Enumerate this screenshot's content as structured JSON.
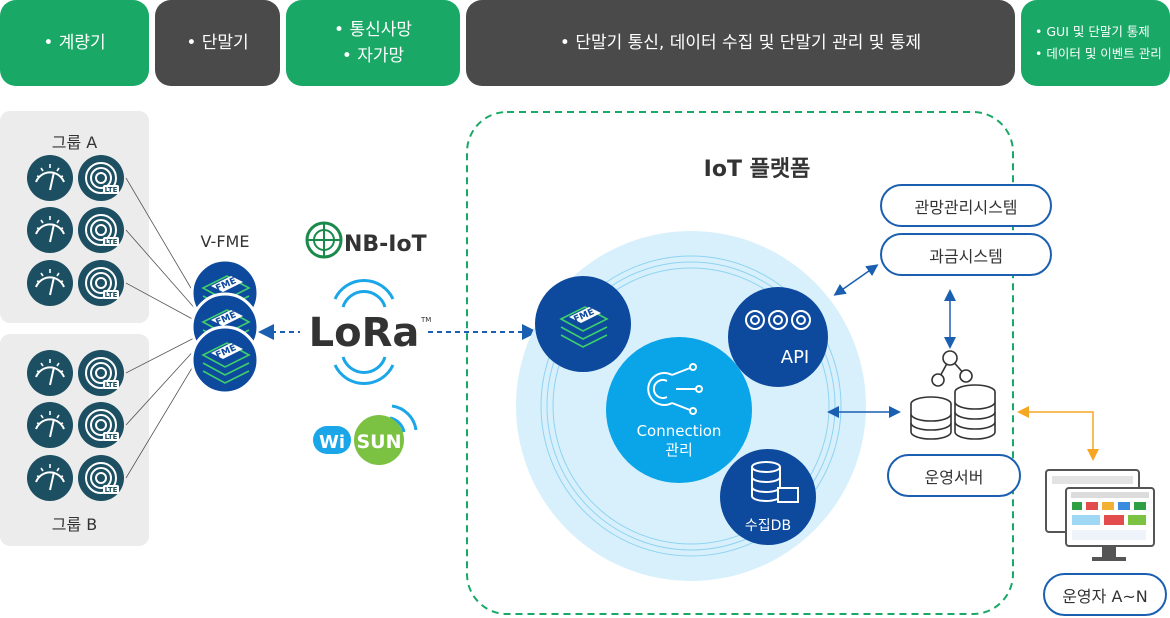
{
  "header": {
    "meter": "계량기",
    "terminal": "단말기",
    "network_1": "통신사망",
    "network_2": "자가망",
    "platform": "단말기 통신, 데이터 수집 및 단말기 관리 및 통제",
    "gui_1": "GUI 및 단말기 통제",
    "gui_2": "데이터 및 이벤트 관리"
  },
  "groups": {
    "a_label": "그룹 A",
    "b_label": "그룹 B",
    "device_badge": "LTE"
  },
  "vfme": {
    "label": "V-FME",
    "module_text": "FME"
  },
  "networks": {
    "nbiot": "NB-IoT",
    "lora": "LoRa",
    "lora_tm": "TM",
    "wisun_wi": "Wi",
    "wisun_sun": "SUN"
  },
  "platform": {
    "title": "IoT 플랫폼",
    "fme": "FME",
    "api": "API",
    "connection": "Connection",
    "connection_sub": "관리",
    "db": "수집DB"
  },
  "right": {
    "nms": "관망관리시스템",
    "billing": "과금시스템",
    "server": "운영서버",
    "operator": "운영자 A~N"
  },
  "colors": {
    "green": "#1aa866",
    "gray": "#4a4a4a",
    "navy": "#0d4a9e",
    "cyan": "#1aa6e8",
    "orange": "#f5a623"
  }
}
